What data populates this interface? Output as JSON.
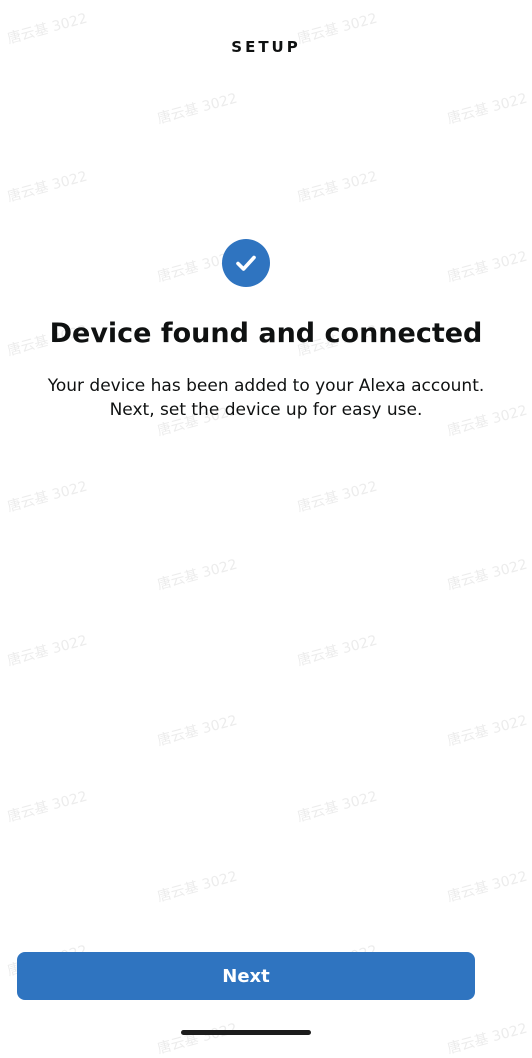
{
  "header": {
    "title": "SETUP"
  },
  "status": {
    "icon": "check-circle-icon",
    "accent_color": "#2f74c0",
    "title": "Device found and connected",
    "message": "Your device has been added to your Alexa account. Next, set the device up for easy use."
  },
  "actions": {
    "next_label": "Next",
    "button_color": "#2f74c0"
  },
  "watermark": {
    "text": "唐云基 3022"
  }
}
